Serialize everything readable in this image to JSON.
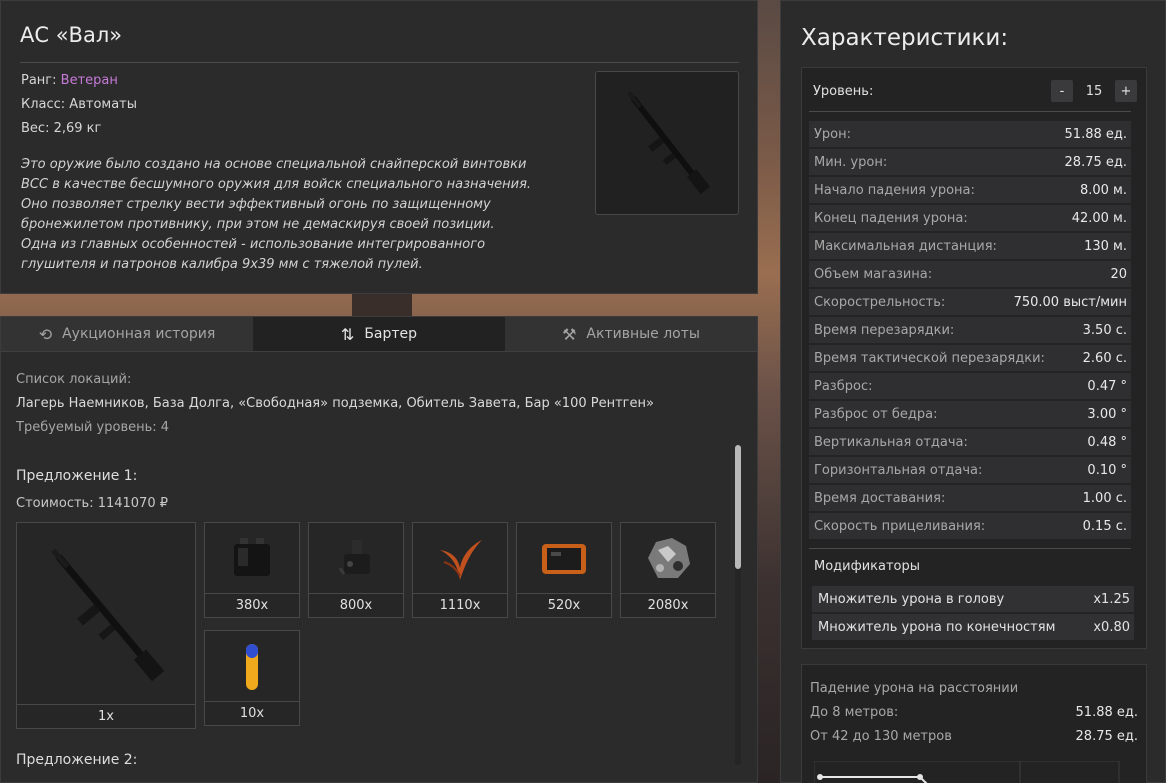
{
  "item": {
    "name": "АС «Вал»",
    "rank_label": "Ранг:",
    "rank_value": "Ветеран",
    "rank_color": "#c77ad8",
    "class_text": "Класс: Автоматы",
    "weight_text": "Вес: 2,69 кг",
    "description": [
      "Это оружие было создано на основе специальной снайперской винтовки",
      "ВСС в качестве бесшумного оружия для войск специального назначения.",
      "Оно позволяет стрелку вести эффективный огонь по защищенному",
      "бронежилетом противнику, при этом не демаскируя своей позиции.",
      "Одна из главных особенностей - использование интегрированного",
      "глушителя и патронов калибра 9х39 мм с тяжелой пулей."
    ]
  },
  "tabs": [
    {
      "label": "Аукционная история",
      "icon": "history-icon",
      "active": false
    },
    {
      "label": "Бартер",
      "icon": "swap-arrows-icon",
      "active": true
    },
    {
      "label": "Активные лоты",
      "icon": "gavel-icon",
      "active": false
    }
  ],
  "barter": {
    "locations_label": "Список локаций:",
    "locations": "Лагерь Наемников, База Долга, «Свободная» подземка, Обитель Завета, Бар «100 Рентген»",
    "required_level": "Требуемый уровень: 4",
    "offer1": {
      "title": "Предложение 1:",
      "cost": "Стоимость: 1141070 ₽",
      "main_qty": "1x",
      "items": [
        {
          "qty": "380x",
          "icon": "battery-icon"
        },
        {
          "qty": "800x",
          "icon": "device-icon"
        },
        {
          "qty": "1110x",
          "icon": "fern-icon"
        },
        {
          "qty": "520x",
          "icon": "tablet-icon"
        },
        {
          "qty": "2080x",
          "icon": "ore-icon"
        },
        {
          "qty": "10x",
          "icon": "vial-icon"
        }
      ]
    },
    "offer2_title": "Предложение 2:"
  },
  "stats": {
    "title": "Характеристики:",
    "level_label": "Уровень:",
    "level_minus": "-",
    "level_plus": "+",
    "level_value": "15",
    "rows": [
      {
        "k": "Урон:",
        "v": "51.88 ед."
      },
      {
        "k": "Мин. урон:",
        "v": "28.75 ед."
      },
      {
        "k": "Начало падения урона:",
        "v": "8.00 м."
      },
      {
        "k": "Конец падения урона:",
        "v": "42.00 м."
      },
      {
        "k": "Максимальная дистанция:",
        "v": "130 м."
      },
      {
        "k": "Объем магазина:",
        "v": "20"
      },
      {
        "k": "Скорострельность:",
        "v": "750.00 выст/мин"
      },
      {
        "k": "Время перезарядки:",
        "v": "3.50 с."
      },
      {
        "k": "Время тактической перезарядки:",
        "v": "2.60 с."
      },
      {
        "k": "Разброс:",
        "v": "0.47 °"
      },
      {
        "k": "Разброс от бедра:",
        "v": "3.00 °"
      },
      {
        "k": "Вертикальная отдача:",
        "v": "0.48 °"
      },
      {
        "k": "Горизонтальная отдача:",
        "v": "0.10 °"
      },
      {
        "k": "Время доставания:",
        "v": "1.00 с."
      },
      {
        "k": "Скорость прицеливания:",
        "v": "0.15 с."
      }
    ],
    "modifiers_title": "Модификаторы",
    "modifiers": [
      {
        "k": "Множитель урона в голову",
        "v": "x1.25"
      },
      {
        "k": "Множитель урона по конечностям",
        "v": "x0.80"
      }
    ],
    "falloff_title": "Падение урона на расстоянии",
    "falloff": [
      {
        "k": "До 8 метров:",
        "v": "51.88 ед."
      },
      {
        "k": "От 42 до 130 метров",
        "v": "28.75 ед."
      }
    ]
  },
  "colors": {
    "panel": "#2b2b2c",
    "accent_rank": "#c77ad8"
  }
}
